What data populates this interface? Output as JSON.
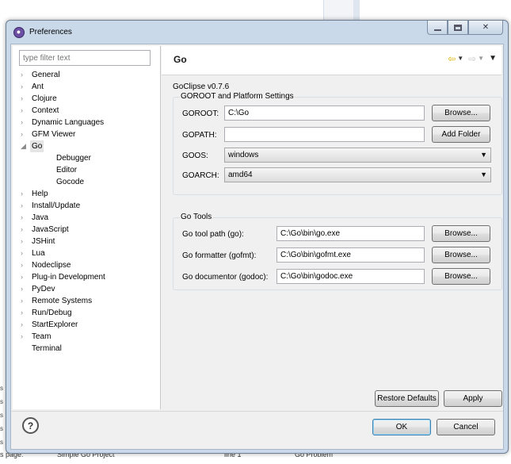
{
  "dialog": {
    "title": "Preferences",
    "filter_placeholder": "type filter text"
  },
  "tree": [
    {
      "label": "General",
      "expanded": false,
      "selected": false
    },
    {
      "label": "Ant",
      "expanded": false,
      "selected": false
    },
    {
      "label": "Clojure",
      "expanded": false,
      "selected": false
    },
    {
      "label": "Context",
      "expanded": false,
      "selected": false
    },
    {
      "label": "Dynamic Languages",
      "expanded": false,
      "selected": false
    },
    {
      "label": "GFM Viewer",
      "expanded": false,
      "selected": false
    },
    {
      "label": "Go",
      "expanded": true,
      "selected": true
    },
    {
      "label": "Debugger",
      "child": true
    },
    {
      "label": "Editor",
      "child": true
    },
    {
      "label": "Gocode",
      "child": true
    },
    {
      "label": "Help",
      "expanded": false
    },
    {
      "label": "Install/Update",
      "expanded": false
    },
    {
      "label": "Java",
      "expanded": false
    },
    {
      "label": "JavaScript",
      "expanded": false
    },
    {
      "label": "JSHint",
      "expanded": false
    },
    {
      "label": "Lua",
      "expanded": false
    },
    {
      "label": "Nodeclipse",
      "expanded": false
    },
    {
      "label": "Plug-in Development",
      "expanded": false
    },
    {
      "label": "PyDev",
      "expanded": false
    },
    {
      "label": "Remote Systems",
      "expanded": false
    },
    {
      "label": "Run/Debug",
      "expanded": false
    },
    {
      "label": "StartExplorer",
      "expanded": false
    },
    {
      "label": "Team",
      "expanded": false
    },
    {
      "label": "Terminal",
      "leaf": true
    }
  ],
  "page": {
    "title": "Go",
    "version": "GoClipse v0.7.6",
    "goroot_group": {
      "title": "GOROOT and Platform Settings",
      "goroot_label": "GOROOT:",
      "goroot_value": "C:\\Go",
      "browse_label": "Browse...",
      "gopath_label": "GOPATH:",
      "gopath_value": "",
      "add_folder_label": "Add Folder",
      "goos_label": "GOOS:",
      "goos_value": "windows",
      "goarch_label": "GOARCH:",
      "goarch_value": "amd64"
    },
    "tools_group": {
      "title": "Go Tools",
      "tools": [
        {
          "label": "Go tool path (go):",
          "value": "C:\\Go\\bin\\go.exe",
          "button": "Browse..."
        },
        {
          "label": "Go formatter (gofmt):",
          "value": "C:\\Go\\bin\\gofmt.exe",
          "button": "Browse..."
        },
        {
          "label": "Go documentor (godoc):",
          "value": "C:\\Go\\bin\\godoc.exe",
          "button": "Browse..."
        }
      ]
    },
    "restore_defaults_label": "Restore Defaults",
    "apply_label": "Apply"
  },
  "footer": {
    "help_glyph": "?",
    "ok_label": "OK",
    "cancel_label": "Cancel"
  },
  "background": {
    "row_cells": [
      "s page:",
      "Simple Go Project",
      "line 1",
      "Go Problem"
    ],
    "edge_chars": "s"
  }
}
